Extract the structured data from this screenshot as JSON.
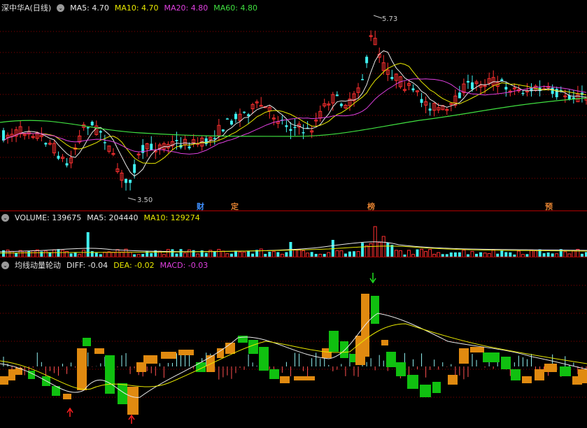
{
  "price_panel": {
    "title": "深中华A(日线)",
    "ma": [
      {
        "label": "MA5: 4.70",
        "color": "#e8e8e8"
      },
      {
        "label": "MA10: 4.70",
        "color": "#e8e800"
      },
      {
        "label": "MA20: 4.80",
        "color": "#e040e0"
      },
      {
        "label": "MA60: 4.80",
        "color": "#40e040"
      }
    ],
    "high_label": "5.73",
    "low_label": "3.50",
    "event_tags": [
      {
        "text": "财",
        "color": "#4090ff"
      },
      {
        "text": "定",
        "color": "#e08030"
      },
      {
        "text": "榜",
        "color": "#e08030"
      },
      {
        "text": "预",
        "color": "#e08030"
      }
    ]
  },
  "volume_panel": {
    "items": [
      {
        "label": "VOLUME: 139675",
        "color": "#e8e8e8"
      },
      {
        "label": "MA5: 204440",
        "color": "#e8e8e8"
      },
      {
        "label": "MA10: 129274",
        "color": "#e8e800"
      }
    ]
  },
  "macd_panel": {
    "title": "均线动量轮动",
    "items": [
      {
        "label": "DIFF: -0.04",
        "color": "#e8e8e8"
      },
      {
        "label": "DEA: -0.02",
        "color": "#e8e800"
      },
      {
        "label": "MACD: -0.03",
        "color": "#e040e0"
      }
    ]
  },
  "colors": {
    "up": "#ff3030",
    "down": "#40f0f0",
    "grid": "#8b0000",
    "macd_pos": "#e08a10",
    "macd_neg": "#10c010"
  },
  "icons": [
    "collapse-circle-icon"
  ]
}
